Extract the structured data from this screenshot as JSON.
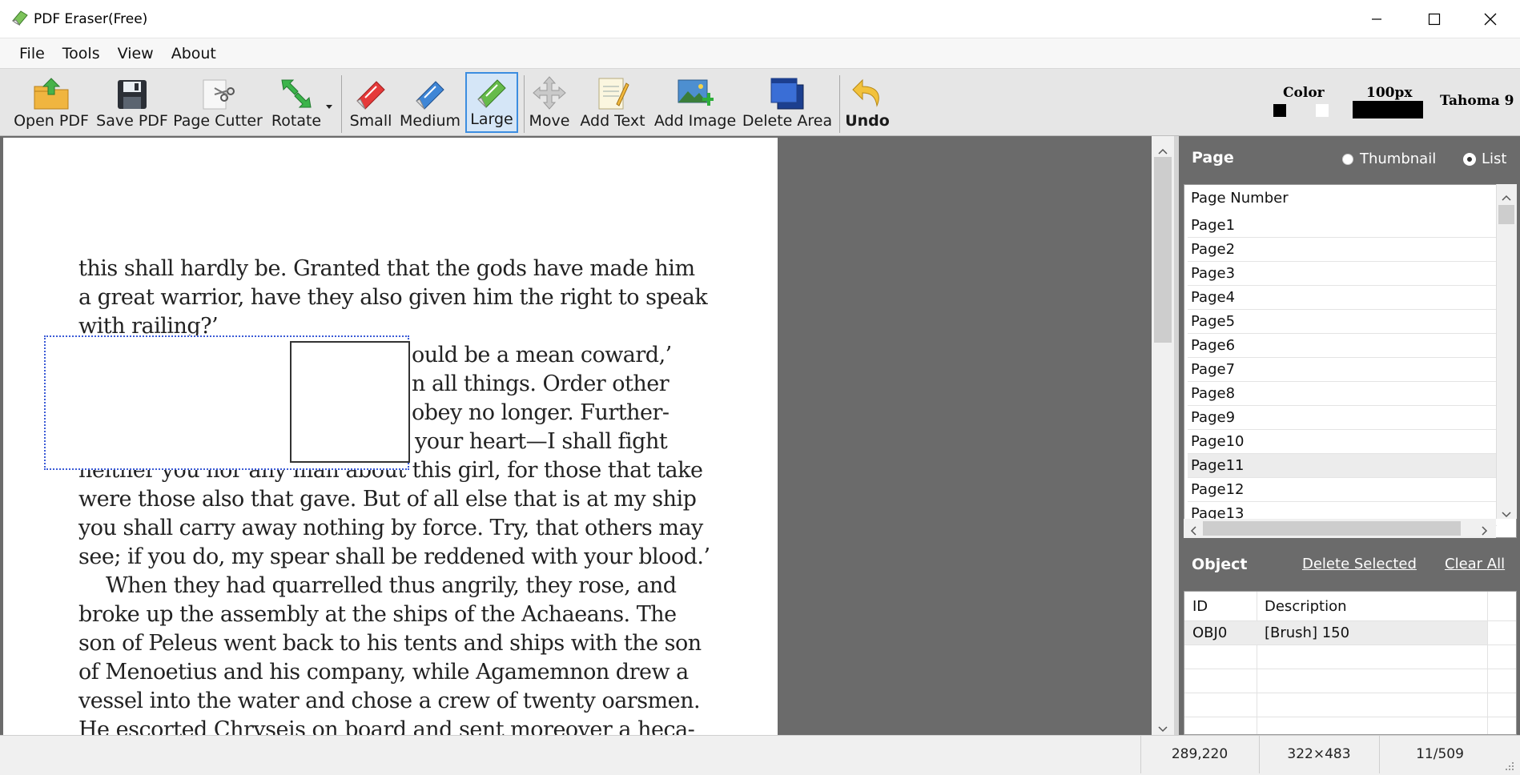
{
  "window": {
    "title": "PDF Eraser(Free)",
    "controls": [
      "minimize",
      "maximize",
      "close"
    ]
  },
  "menu": [
    "File",
    "Tools",
    "View",
    "About"
  ],
  "toolbar": {
    "open_pdf": "Open PDF",
    "save_pdf": "Save PDF",
    "page_cutter": "Page Cutter",
    "rotate": "Rotate",
    "small": "Small",
    "medium": "Medium",
    "large": "Large",
    "move": "Move",
    "add_text": "Add Text",
    "add_image": "Add Image",
    "delete_area": "Delete Area",
    "undo": "Undo",
    "selected_tool": "Large",
    "color_label": "Color",
    "size_label": "100px",
    "font_label": "Tahoma 9",
    "colors": {
      "primary": "#000000",
      "secondary": "#ffffff"
    }
  },
  "document": {
    "lines": [
      "this shall hardly be. Granted that the gods have made him",
      "a great warrior, have they also given him the right to speak",
      "with railing?’",
      "ould be a mean coward,’",
      "n all things. Order other",
      "obey no longer. Further-",
      "your heart—I shall fight",
      "neither you nor any man about this girl, for those that take",
      "were those also that gave. But of all else that is at my ship",
      "you shall carry away nothing by force. Try, that others may",
      "see; if you do, my spear shall be reddened with your blood.’",
      "When they had quarrelled thus angrily, they rose, and",
      "broke up the assembly at the ships of the Achaeans. The",
      "son of Peleus went back to his tents and ships with the son",
      "of Menoetius and his company, while Agamemnon drew a",
      "vessel into the water and chose a crew of twenty oarsmen.",
      "He escorted Chryseis on board and sent moreover a heca-"
    ]
  },
  "page_panel": {
    "title": "Page",
    "view_options": [
      {
        "label": "Thumbnail",
        "selected": false
      },
      {
        "label": "List",
        "selected": true
      }
    ],
    "column_header": "Page Number",
    "pages": [
      "Page1",
      "Page2",
      "Page3",
      "Page4",
      "Page5",
      "Page6",
      "Page7",
      "Page8",
      "Page9",
      "Page10",
      "Page11",
      "Page12",
      "Page13"
    ],
    "selected_page": "Page11"
  },
  "object_panel": {
    "title": "Object",
    "delete_selected": "Delete Selected",
    "clear_all": "Clear All",
    "columns": [
      "ID",
      "Description"
    ],
    "rows": [
      {
        "id": "OBJ0",
        "description": "[Brush] 150"
      }
    ]
  },
  "status": {
    "cursor": "289,220",
    "page_size": "322×483",
    "page_index": "11/509"
  }
}
